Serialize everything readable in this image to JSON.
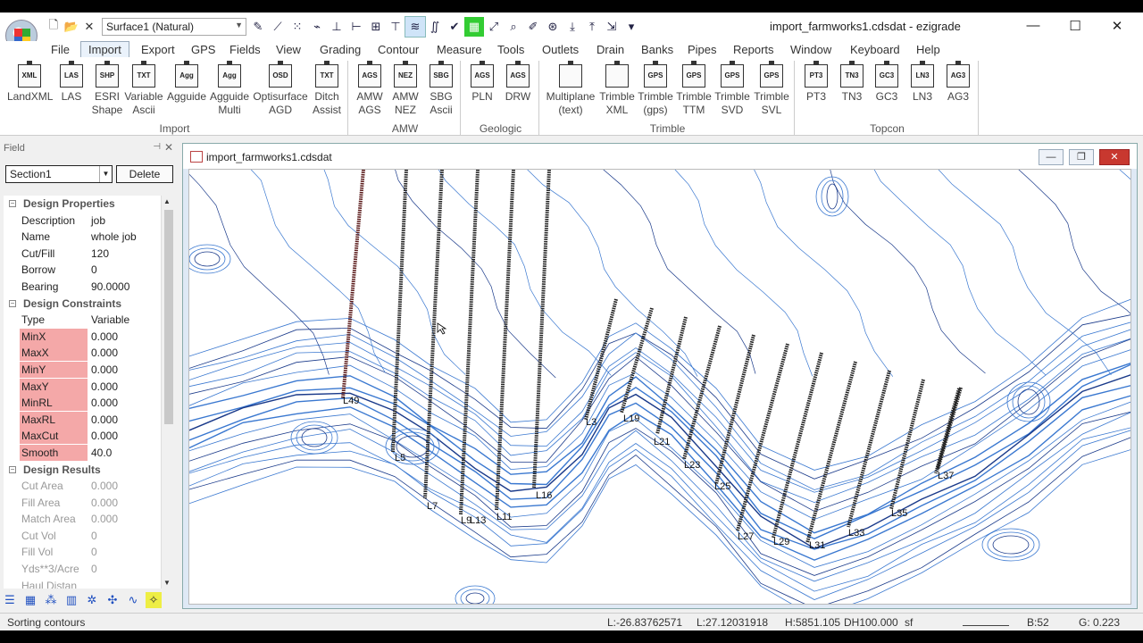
{
  "window": {
    "title": "import_farmworks1.cdsdat - ezigrade",
    "surface_select": "Surface1 (Natural)",
    "minimize": "—",
    "maximize": "☐",
    "close": "✕"
  },
  "menus": [
    "File",
    "Import",
    "Export",
    "GPS",
    "Fields",
    "View",
    "Grading",
    "Contour",
    "Measure",
    "Tools",
    "Outlets",
    "Drain",
    "Banks",
    "Pipes",
    "Reports",
    "Window",
    "Keyboard",
    "Help"
  ],
  "ribbon": {
    "groups": [
      {
        "label": "Import",
        "buttons": [
          {
            "icon": "XML",
            "l1": "LandXML",
            "l2": ""
          },
          {
            "icon": "LAS",
            "l1": "LAS",
            "l2": ""
          },
          {
            "icon": "SHP",
            "l1": "ESRI",
            "l2": "Shape"
          },
          {
            "icon": "TXT",
            "l1": "Variable",
            "l2": "Ascii"
          },
          {
            "icon": "Agg",
            "l1": "Agguide",
            "l2": ""
          },
          {
            "icon": "Agg",
            "l1": "Agguide",
            "l2": "Multi"
          },
          {
            "icon": "OSD",
            "l1": "Optisurface",
            "l2": "AGD"
          },
          {
            "icon": "TXT",
            "l1": "Ditch",
            "l2": "Assist"
          }
        ]
      },
      {
        "label": "AMW",
        "buttons": [
          {
            "icon": "AGS",
            "l1": "AMW",
            "l2": "AGS"
          },
          {
            "icon": "NEZ",
            "l1": "AMW",
            "l2": "NEZ"
          },
          {
            "icon": "SBG",
            "l1": "SBG",
            "l2": "Ascii"
          }
        ]
      },
      {
        "label": "Geologic",
        "buttons": [
          {
            "icon": "AGS",
            "l1": "PLN",
            "l2": ""
          },
          {
            "icon": "AGS",
            "l1": "DRW",
            "l2": ""
          }
        ]
      },
      {
        "label": "Trimble",
        "buttons": [
          {
            "icon": "",
            "l1": "Multiplane",
            "l2": "(text)"
          },
          {
            "icon": "",
            "l1": "Trimble",
            "l2": "XML"
          },
          {
            "icon": "GPS",
            "l1": "Trimble",
            "l2": "(gps)"
          },
          {
            "icon": "GPS",
            "l1": "Trimble",
            "l2": "TTM"
          },
          {
            "icon": "GPS",
            "l1": "Trimble",
            "l2": "SVD"
          },
          {
            "icon": "GPS",
            "l1": "Trimble",
            "l2": "SVL"
          }
        ]
      },
      {
        "label": "Topcon",
        "buttons": [
          {
            "icon": "PT3",
            "l1": "PT3",
            "l2": ""
          },
          {
            "icon": "TN3",
            "l1": "TN3",
            "l2": ""
          },
          {
            "icon": "GC3",
            "l1": "GC3",
            "l2": ""
          },
          {
            "icon": "LN3",
            "l1": "LN3",
            "l2": ""
          },
          {
            "icon": "AG3",
            "l1": "AG3",
            "l2": ""
          }
        ]
      }
    ]
  },
  "field_panel": {
    "title": "Field",
    "pin": "⊣",
    "close": "✕",
    "section": "Section1",
    "delete_label": "Delete",
    "rows": [
      {
        "type": "cat",
        "key": "Design Properties"
      },
      {
        "key": "Description",
        "value": "job"
      },
      {
        "key": "Name",
        "value": "whole job"
      },
      {
        "key": "Cut/Fill",
        "value": "120"
      },
      {
        "key": "Borrow",
        "value": "0"
      },
      {
        "key": "Bearing",
        "value": "90.0000"
      },
      {
        "type": "cat",
        "key": "Design Constraints"
      },
      {
        "key": "Type",
        "value": "Variable"
      },
      {
        "type": "warn",
        "key": "MinX",
        "value": "0.000"
      },
      {
        "type": "warn",
        "key": "MaxX",
        "value": "0.000"
      },
      {
        "type": "warn",
        "key": "MinY",
        "value": "0.000"
      },
      {
        "type": "warn",
        "key": "MaxY",
        "value": "0.000"
      },
      {
        "type": "warn",
        "key": "MinRL",
        "value": "0.000"
      },
      {
        "type": "warn",
        "key": "MaxRL",
        "value": "0.000"
      },
      {
        "type": "warn",
        "key": "MaxCut",
        "value": "0.000"
      },
      {
        "type": "warn",
        "key": "Smooth",
        "value": "40.0"
      },
      {
        "type": "cat",
        "key": "Design Results"
      },
      {
        "type": "dim",
        "key": "Cut Area",
        "value": "0.000"
      },
      {
        "type": "dim",
        "key": "Fill Area",
        "value": "0.000"
      },
      {
        "type": "dim",
        "key": "Match Area",
        "value": "0.000"
      },
      {
        "type": "dim",
        "key": "Cut Vol",
        "value": "0"
      },
      {
        "type": "dim",
        "key": "Fill Vol",
        "value": "0"
      },
      {
        "type": "dim",
        "key": "Yds**3/Acre",
        "value": "0"
      },
      {
        "type": "dim",
        "key": "Haul Distan",
        "value": ""
      }
    ]
  },
  "document": {
    "title": "import_farmworks1.cdsdat",
    "min": "—",
    "max": "❐",
    "close": "✕"
  },
  "map": {
    "line_color": "#222222",
    "first_line_color": "#5a1a1a",
    "contour_color": "#3a78d0",
    "contour_dark": "#1a3a8a",
    "labels": [
      "L49",
      "L5",
      "L7",
      "L9",
      "L13",
      "L11",
      "L16",
      "L3",
      "L19",
      "L21",
      "L23",
      "L25",
      "L27",
      "L29",
      "L31",
      "L33",
      "L35",
      "L37"
    ]
  },
  "status": {
    "message": "Sorting contours",
    "l1": "L:-26.83762571",
    "l2": "L:27.12031918",
    "h": "H:5851.105",
    "dh": "DH100.000",
    "unit": "sf",
    "b": "B:52",
    "g": "G: 0.223"
  }
}
